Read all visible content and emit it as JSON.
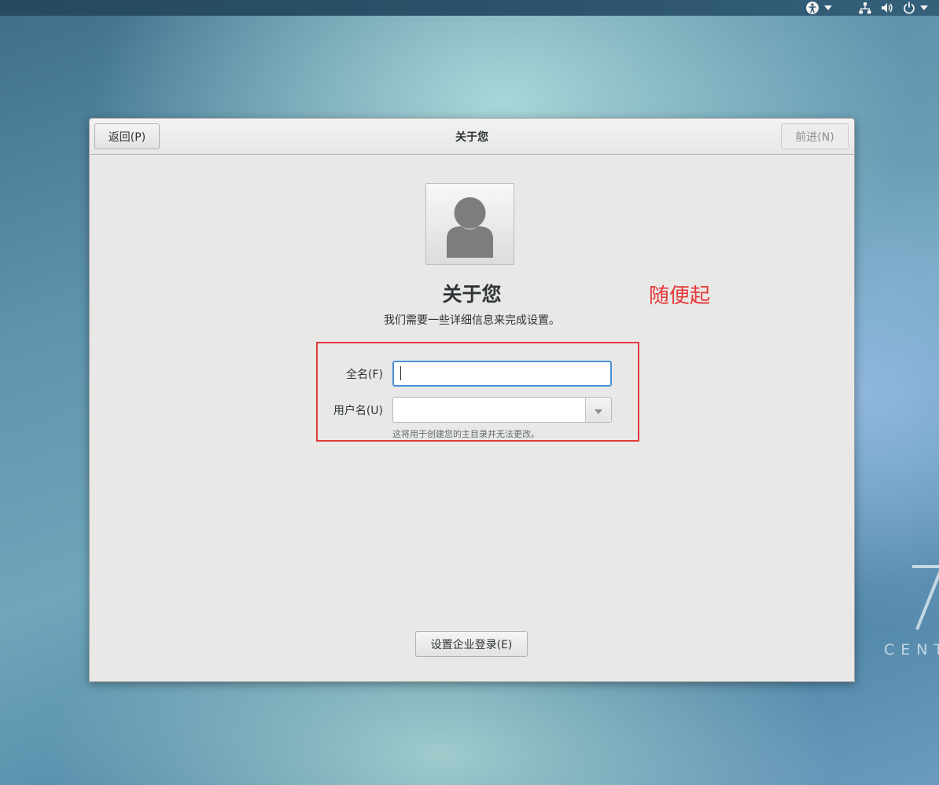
{
  "topbar": {
    "icons": [
      "accessibility-icon",
      "chevron-down-icon",
      "network-icon",
      "volume-icon",
      "power-icon",
      "chevron-down-icon"
    ]
  },
  "desktop": {
    "brand_text": "CENT"
  },
  "window": {
    "title": "关于您",
    "back_label": "返回(P)",
    "next_label": "前进(N)",
    "avatar_icon": "user-avatar-icon",
    "heading": "关于您",
    "subtitle": "我们需要一些详细信息来完成设置。",
    "annotation": "随便起",
    "form": {
      "fullname_label": "全名(F)",
      "fullname_value": "",
      "username_label": "用户名(U)",
      "username_value": "",
      "username_hint": "这将用于创建您的主目录并无法更改。"
    },
    "enterprise_label": "设置企业登录(E)"
  },
  "colors": {
    "annotation_red": "#e63838",
    "focus_blue": "#4a90d9"
  }
}
